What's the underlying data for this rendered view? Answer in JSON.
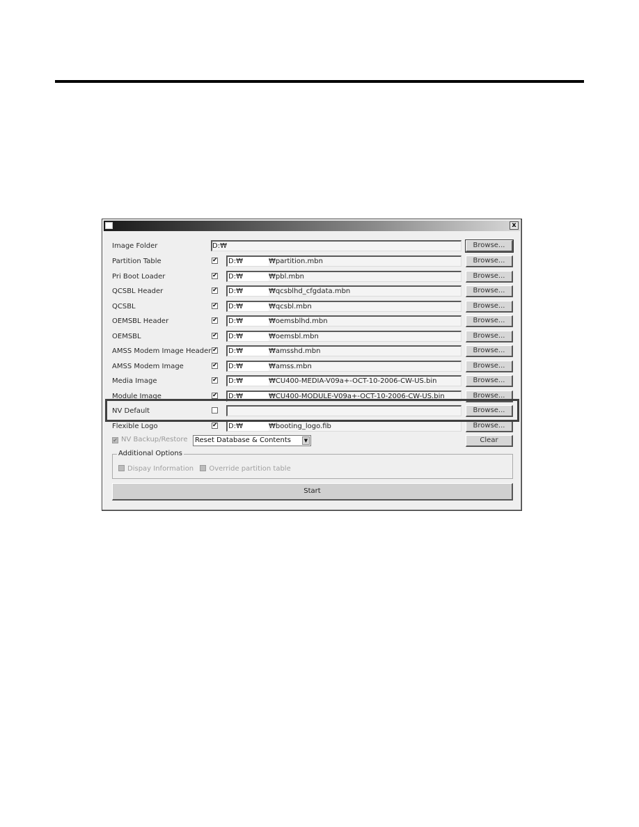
{
  "dialog": {
    "title": "",
    "close_label": "x"
  },
  "image_folder": {
    "label": "Image Folder",
    "value": "D:₩",
    "browse_label": "Browse..."
  },
  "rows": [
    {
      "label": "Partition Table",
      "checked": true,
      "drive": "D:₩",
      "file": "₩partition.mbn",
      "browse_label": "Browse..."
    },
    {
      "label": "Pri Boot Loader",
      "checked": true,
      "drive": "D:₩",
      "file": "₩pbl.mbn",
      "browse_label": "Browse..."
    },
    {
      "label": "QCSBL Header",
      "checked": true,
      "drive": "D:₩",
      "file": "₩qcsblhd_cfgdata.mbn",
      "browse_label": "Browse..."
    },
    {
      "label": "QCSBL",
      "checked": true,
      "drive": "D:₩",
      "file": "₩qcsbl.mbn",
      "browse_label": "Browse..."
    },
    {
      "label": "OEMSBL Header",
      "checked": true,
      "drive": "D:₩",
      "file": "₩oemsblhd.mbn",
      "browse_label": "Browse..."
    },
    {
      "label": "OEMSBL",
      "checked": true,
      "drive": "D:₩",
      "file": "₩oemsbl.mbn",
      "browse_label": "Browse..."
    },
    {
      "label": "AMSS Modem Image Header",
      "checked": true,
      "drive": "D:₩",
      "file": "₩amsshd.mbn",
      "browse_label": "Browse..."
    },
    {
      "label": "AMSS Modem Image",
      "checked": true,
      "drive": "D:₩",
      "file": "₩amss.mbn",
      "browse_label": "Browse..."
    },
    {
      "label": "Media Image",
      "checked": true,
      "drive": "D:₩",
      "file": "₩CU400-MEDIA-V09a+-OCT-10-2006-CW-US.bin",
      "browse_label": "Browse..."
    },
    {
      "label": "Module Image",
      "checked": true,
      "drive": "D:₩",
      "file": "₩CU400-MODULE-V09a+-OCT-10-2006-CW-US.bin",
      "browse_label": "Browse..."
    },
    {
      "label": "NV Default",
      "checked": false,
      "drive": "",
      "file": "",
      "browse_label": "Browse..."
    },
    {
      "label": "Flexible Logo",
      "checked": true,
      "drive": "D:₩",
      "file": "₩booting_logo.fib",
      "browse_label": "Browse..."
    }
  ],
  "nv_backup": {
    "label": "NV Backup/Restore",
    "checked": true,
    "select_value": "Reset Database & Contents",
    "clear_label": "Clear"
  },
  "additional_options": {
    "legend": "Additional Options",
    "display_info_label": "Dispay Information",
    "override_partition_label": "Override partition table"
  },
  "start_label": "Start",
  "check_glyph": "✔"
}
